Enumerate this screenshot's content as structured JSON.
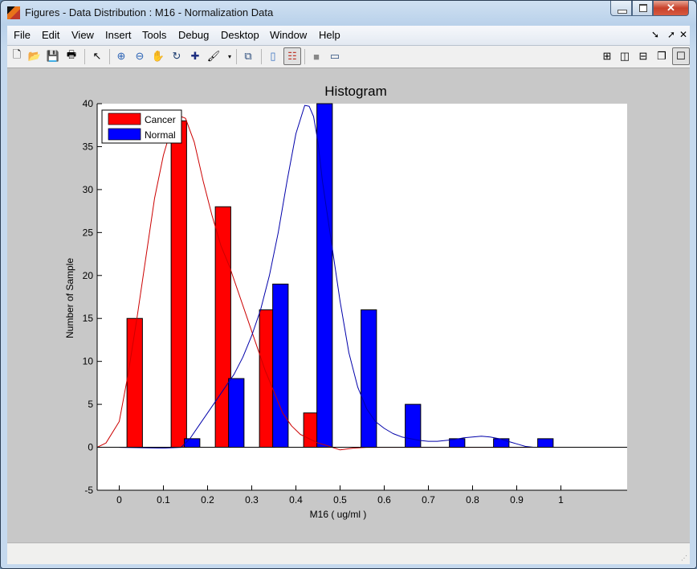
{
  "window": {
    "title": "Figures - Data Distribution : M16 - Normalization Data",
    "close_glyph": "✕"
  },
  "menu": {
    "items": [
      "File",
      "Edit",
      "View",
      "Insert",
      "Tools",
      "Debug",
      "Desktop",
      "Window",
      "Help"
    ],
    "right_icons": [
      "dock-icon",
      "undock-icon",
      "close-icon"
    ],
    "right_glyphs": [
      "➘",
      "➚",
      "✕"
    ]
  },
  "toolbar": {
    "left_tools": [
      {
        "name": "new-figure-icon",
        "glyph": "🗋"
      },
      {
        "name": "open-file-icon",
        "glyph": "📂"
      },
      {
        "name": "save-icon",
        "glyph": "💾"
      },
      {
        "name": "print-icon",
        "glyph": "🖶"
      },
      {
        "name": "select-arrow-icon",
        "glyph": "↖"
      },
      {
        "name": "zoom-in-icon",
        "glyph": "⊕"
      },
      {
        "name": "zoom-out-icon",
        "glyph": "⊖"
      },
      {
        "name": "pan-hand-icon",
        "glyph": "✋"
      },
      {
        "name": "rotate-3d-icon",
        "glyph": "↻"
      },
      {
        "name": "data-cursor-icon",
        "glyph": "✚"
      },
      {
        "name": "brush-icon",
        "glyph": "🖌"
      },
      {
        "name": "link-plot-icon",
        "glyph": "⧉"
      },
      {
        "name": "colorbar-icon",
        "glyph": "▯"
      },
      {
        "name": "legend-icon",
        "glyph": "☷"
      },
      {
        "name": "hide-plot-tools-icon",
        "glyph": "■"
      },
      {
        "name": "show-plot-tools-icon",
        "glyph": "▭"
      }
    ],
    "right_tools": [
      {
        "name": "tile-grid-icon",
        "glyph": "⊞"
      },
      {
        "name": "tile-columns-icon",
        "glyph": "◫"
      },
      {
        "name": "tile-rows-icon",
        "glyph": "⊟"
      },
      {
        "name": "float-icon",
        "glyph": "❐"
      },
      {
        "name": "maximize-icon",
        "glyph": "☐"
      }
    ]
  },
  "chart_data": {
    "type": "bar",
    "title": "Histogram",
    "xlabel": "M16 ( ug/ml )",
    "ylabel": "Number of Sample",
    "xlim": [
      -0.05,
      1.15
    ],
    "ylim": [
      -5,
      40
    ],
    "xticks": [
      0,
      0.1,
      0.2,
      0.3,
      0.4,
      0.5,
      0.6,
      0.7,
      0.8,
      0.9,
      1
    ],
    "xtick_labels": [
      "0",
      "0.1",
      "0.2",
      "0.3",
      "0.4",
      "0.5",
      "0.6",
      "0.7",
      "0.8",
      "0.9",
      "1"
    ],
    "yticks": [
      -5,
      0,
      5,
      10,
      15,
      20,
      25,
      30,
      35,
      40
    ],
    "ytick_labels": [
      "-5",
      "0",
      "5",
      "10",
      "15",
      "20",
      "25",
      "30",
      "35",
      "40"
    ],
    "grid": false,
    "legend": {
      "position": "top-left",
      "entries": [
        "Cancer",
        "Normal"
      ]
    },
    "bar_width": 0.035,
    "series": [
      {
        "name": "Cancer",
        "color": "#ff0000",
        "x": [
          0.035,
          0.135,
          0.235,
          0.335,
          0.435
        ],
        "values": [
          15,
          38,
          28,
          16,
          4
        ]
      },
      {
        "name": "Normal",
        "color": "#0000ff",
        "x": [
          0.165,
          0.265,
          0.365,
          0.465,
          0.565,
          0.665,
          0.765,
          0.865,
          0.965
        ],
        "values": [
          1,
          8,
          19,
          40,
          16,
          5,
          1,
          1,
          1
        ]
      }
    ],
    "fit_curves": [
      {
        "name": "Cancer fit",
        "color": "#cc0000",
        "x": [
          -0.05,
          -0.03,
          0.0,
          0.02,
          0.04,
          0.06,
          0.08,
          0.1,
          0.12,
          0.14,
          0.15,
          0.17,
          0.19,
          0.21,
          0.23,
          0.25,
          0.27,
          0.29,
          0.31,
          0.33,
          0.35,
          0.37,
          0.39,
          0.41,
          0.43,
          0.45,
          0.47,
          0.5,
          0.53,
          0.56,
          0.6,
          0.7,
          0.8,
          0.9,
          0.93
        ],
        "y": [
          0,
          0.5,
          3,
          8.5,
          15,
          22,
          29,
          34,
          37.5,
          38.5,
          38.3,
          35.5,
          31,
          27,
          23.5,
          21,
          18,
          15,
          12,
          9,
          6.5,
          4,
          2.5,
          1.5,
          1,
          0.5,
          0.2,
          -0.3,
          -0.1,
          0,
          0,
          0,
          0,
          0,
          0
        ]
      },
      {
        "name": "Normal fit",
        "color": "#0000aa",
        "x": [
          0.0,
          0.1,
          0.14,
          0.16,
          0.18,
          0.2,
          0.22,
          0.24,
          0.26,
          0.28,
          0.3,
          0.32,
          0.34,
          0.36,
          0.38,
          0.4,
          0.42,
          0.43,
          0.44,
          0.45,
          0.46,
          0.48,
          0.5,
          0.52,
          0.54,
          0.56,
          0.58,
          0.6,
          0.62,
          0.64,
          0.66,
          0.68,
          0.7,
          0.72,
          0.74,
          0.76,
          0.78,
          0.8,
          0.82,
          0.84,
          0.86,
          0.88,
          0.9,
          0.92,
          0.94
        ],
        "y": [
          0,
          -0.1,
          0,
          1,
          2.5,
          4,
          5.5,
          7,
          8.5,
          10.5,
          13,
          16,
          20,
          25,
          31,
          36.5,
          39.8,
          39.7,
          38.5,
          35.5,
          31,
          24,
          17,
          11,
          7,
          4.5,
          3,
          2.2,
          1.6,
          1.2,
          1,
          0.8,
          0.7,
          0.7,
          0.8,
          0.9,
          1.1,
          1.2,
          1.3,
          1.2,
          1,
          0.7,
          0.4,
          0.1,
          0
        ]
      }
    ]
  }
}
